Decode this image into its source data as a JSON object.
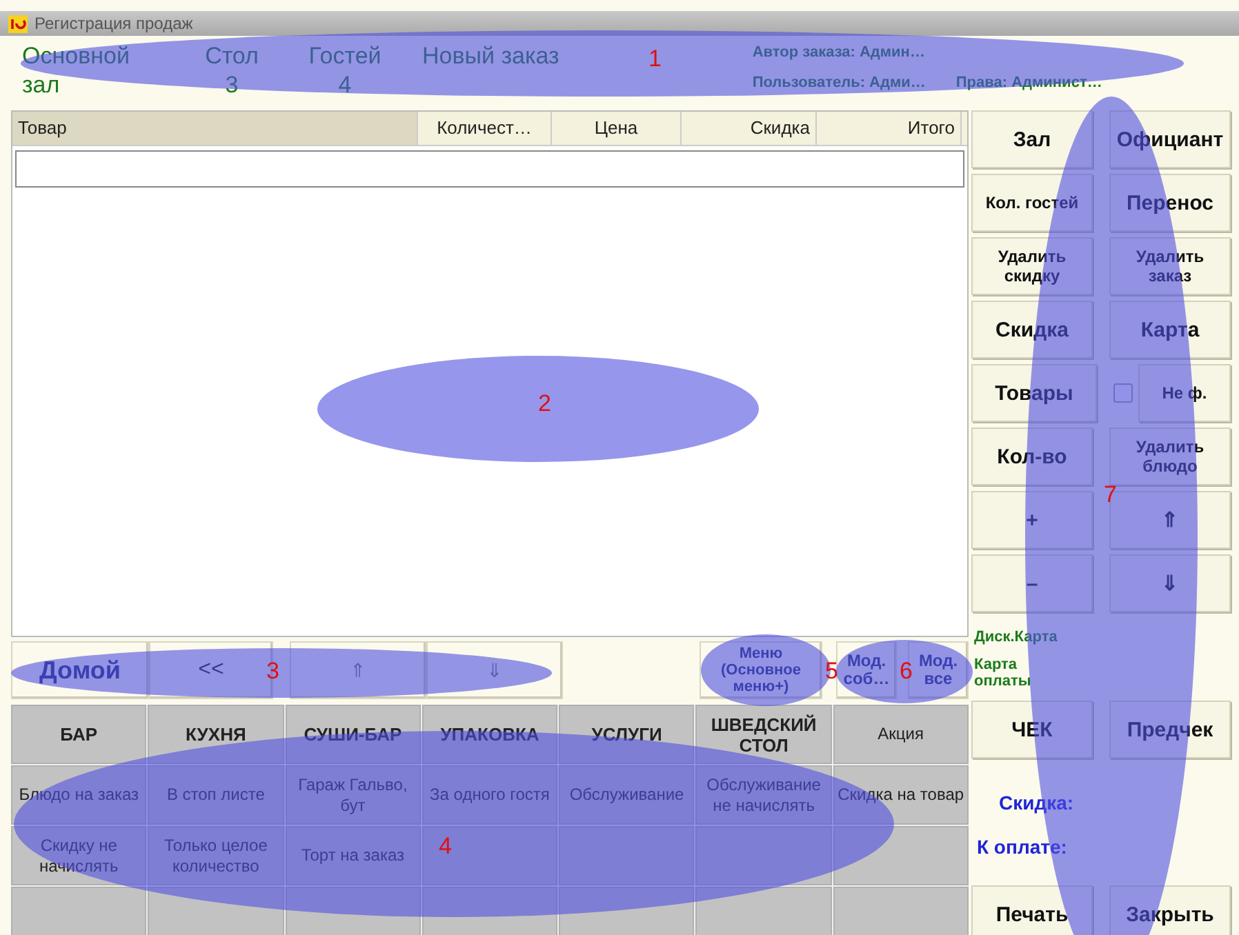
{
  "window": {
    "title": "Регистрация продаж"
  },
  "header": {
    "hall": "Основной зал",
    "table_label": "Стол",
    "table_value": "3",
    "guests_label": "Гостей",
    "guests_value": "4",
    "order": "Новый заказ",
    "author": "Автор заказа: Админ…",
    "user": "Пользователь: Адми…",
    "rights": "Права: Админист…"
  },
  "table": {
    "columns": [
      "Товар",
      "Количест…",
      "Цена",
      "Скидка",
      "Итого"
    ]
  },
  "side_buttons": [
    [
      {
        "kind": "button",
        "label": "Зал"
      },
      {
        "kind": "button",
        "label": "Официант"
      }
    ],
    [
      {
        "kind": "button",
        "label": "Кол. гостей"
      },
      {
        "kind": "button",
        "label": "Перенос"
      }
    ],
    [
      {
        "kind": "button",
        "label": "Удалить скидку"
      },
      {
        "kind": "button",
        "label": "Удалить заказ"
      }
    ],
    [
      {
        "kind": "button",
        "label": "Скидка"
      },
      {
        "kind": "button",
        "label": "Карта"
      }
    ],
    [
      {
        "kind": "button",
        "label": "Товары"
      },
      {
        "kind": "check",
        "checked": false,
        "label": "Не ф."
      }
    ],
    [
      {
        "kind": "button",
        "label": "Кол-во"
      },
      {
        "kind": "button",
        "label": "Удалить блюдо"
      }
    ],
    [
      {
        "kind": "button",
        "label": "+"
      },
      {
        "kind": "button",
        "label": "⇑"
      }
    ],
    [
      {
        "kind": "button",
        "label": "–"
      },
      {
        "kind": "button",
        "label": "⇓"
      }
    ]
  ],
  "disc_card": "Диск.Карта",
  "pay_card": "Карта оплаты",
  "receipt_buttons": [
    "ЧЕК",
    "Предчек"
  ],
  "totals": [
    "Скидка:",
    "К оплате:"
  ],
  "bottom_buttons": [
    "Печать",
    "Закрыть"
  ],
  "nav": [
    {
      "label": "Домой",
      "disabled": false
    },
    {
      "label": "<<",
      "disabled": false
    },
    {
      "label": "⇑",
      "disabled": true
    },
    {
      "label": "⇓",
      "disabled": true
    }
  ],
  "menu_buttons": [
    "Меню (Основное меню+)",
    "Мод. соб…",
    "Мод. все"
  ],
  "grid": [
    [
      {
        "kind": "group",
        "label": "БАР"
      },
      {
        "kind": "group",
        "label": "КУХНЯ"
      },
      {
        "kind": "group",
        "label": "СУШИ-БАР"
      },
      {
        "kind": "group",
        "label": "УПАКОВКА"
      },
      {
        "kind": "group",
        "label": "УСЛУГИ"
      },
      {
        "kind": "group",
        "label": "ШВЕДСКИЙ СТОЛ"
      },
      {
        "kind": "item",
        "label": "Акция"
      }
    ],
    [
      {
        "kind": "item",
        "label": "Блюдо на заказ"
      },
      {
        "kind": "item",
        "label": "В стоп листе"
      },
      {
        "kind": "item",
        "label": "Гараж Гальво, бут"
      },
      {
        "kind": "item",
        "label": "За одного гостя"
      },
      {
        "kind": "item",
        "label": "Обслуживание"
      },
      {
        "kind": "item",
        "label": "Обслуживание не начислять"
      },
      {
        "kind": "item",
        "label": "Скидка на товар"
      }
    ],
    [
      {
        "kind": "item",
        "label": "Скидку не начислять"
      },
      {
        "kind": "item",
        "label": "Только целое количество"
      },
      {
        "kind": "item",
        "label": "Торт на заказ"
      }
    ]
  ],
  "annotations": [
    "1",
    "2",
    "3",
    "4",
    "5",
    "6",
    "7"
  ]
}
